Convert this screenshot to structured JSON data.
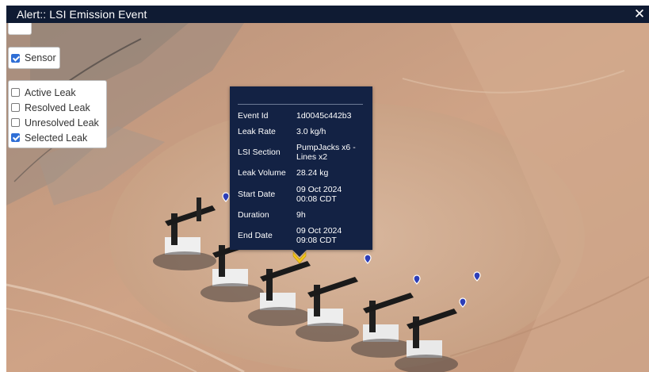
{
  "window": {
    "title": "Alert:: LSI Emission Event",
    "close_glyph": "✕"
  },
  "layers": {
    "sensor": {
      "label": "Sensor",
      "checked": true
    },
    "legend": [
      {
        "label": "Active Leak",
        "checked": false
      },
      {
        "label": "Resolved Leak",
        "checked": false
      },
      {
        "label": "Unresolved Leak",
        "checked": false
      },
      {
        "label": "Selected Leak",
        "checked": true
      }
    ]
  },
  "popup": {
    "rows": [
      {
        "label": "Event Id",
        "value": "1d0045c442b3"
      },
      {
        "label": "Leak Rate",
        "value": "3.0 kg/h"
      },
      {
        "label": "LSI Section",
        "value": "PumpJacks x6 -",
        "value2": "Lines x2"
      },
      {
        "label": "Leak Volume",
        "value": "28.24 kg"
      },
      {
        "label": "Start Date",
        "value": "09 Oct 2024",
        "value2": "00:08 CDT"
      },
      {
        "label": "Duration",
        "value": "9h"
      },
      {
        "label": "End Date",
        "value": "09 Oct 2024",
        "value2": "09:08 CDT"
      }
    ]
  },
  "colors": {
    "titlebar": "#0f1b33",
    "popup_bg": "#132244",
    "sensor_marker": "#2d3eb8",
    "selected_leak_marker": "#f2c51a",
    "checkbox_checked": "#2f6fd6"
  },
  "icons": {
    "close": "close-icon",
    "sensor_marker": "map-pin-icon",
    "leak_marker": "chevron-down-icon"
  }
}
